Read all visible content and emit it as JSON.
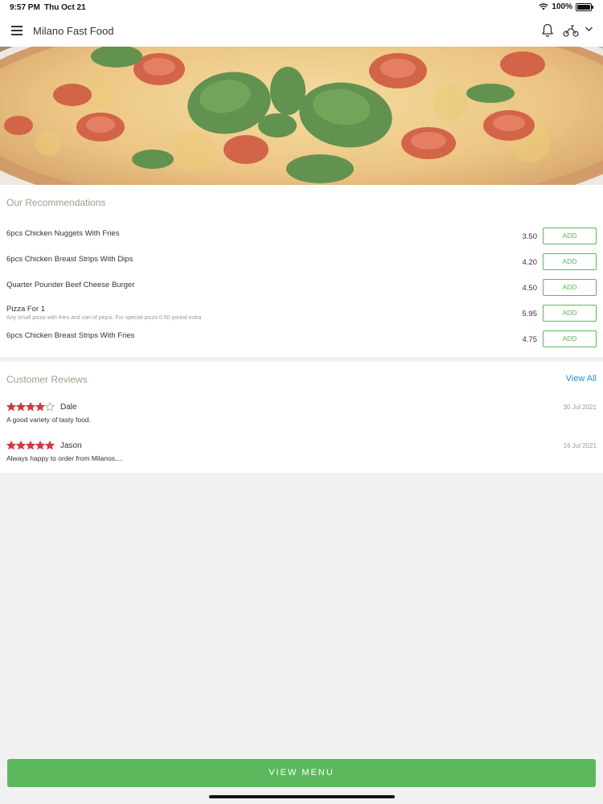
{
  "status_bar": {
    "time": "9:57 PM",
    "date": "Thu Oct 21",
    "battery": "100%",
    "battery_level": 1.0
  },
  "header": {
    "title": "Milano Fast Food",
    "icons": [
      "menu-icon",
      "bell-icon",
      "scooter-icon",
      "chevron-down-icon"
    ]
  },
  "recommendations": {
    "title": "Our Recommendations",
    "add_label": "ADD",
    "items": [
      {
        "name": "6pcs Chicken Nuggets With Fries",
        "description": "",
        "price": "3.50"
      },
      {
        "name": "6pcs Chicken Breast Strips With Dips",
        "description": "",
        "price": "4.20"
      },
      {
        "name": "Quarter Pounder Beef Cheese Burger",
        "description": "",
        "price": "4.50"
      },
      {
        "name": "Pizza For 1",
        "description": "Any small pizza with fries and can of pepsi. For special pizza  0.50 pound extra",
        "price": "5.95"
      },
      {
        "name": "6pcs Chicken Breast Strips With Fries",
        "description": "",
        "price": "4.75"
      }
    ]
  },
  "reviews": {
    "title": "Customer Reviews",
    "view_all": "View All",
    "star_color": "#d9363e",
    "items": [
      {
        "name": "Dale",
        "rating": 4,
        "date": "30 Jul 2021",
        "text": "A good variety of tasty food."
      },
      {
        "name": "Jason",
        "rating": 5,
        "date": "16 Jul 2021",
        "text": "Always happy to order from Milanos...."
      }
    ]
  },
  "footer": {
    "button_label": "VIEW MENU",
    "accent": "#5cb85c"
  }
}
